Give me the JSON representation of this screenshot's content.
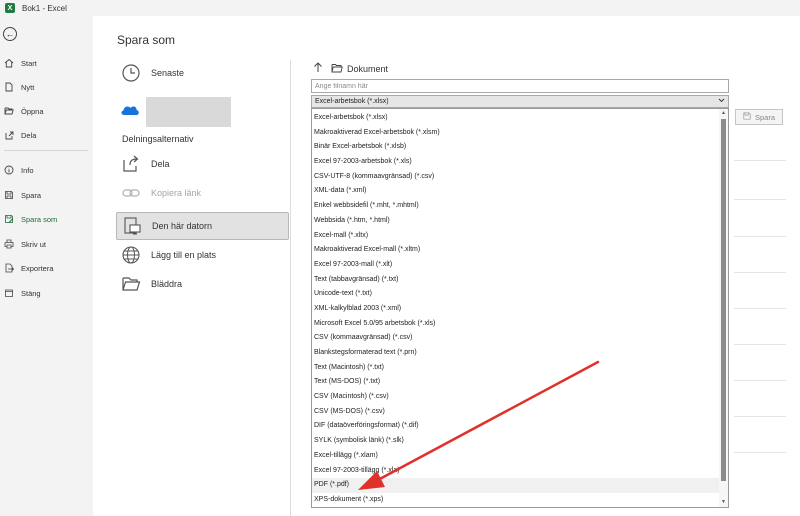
{
  "titlebar": {
    "app_icon": "X",
    "title": "Bok1  -  Excel"
  },
  "nav": {
    "items": [
      {
        "label": "Start",
        "icon": "home-icon"
      },
      {
        "label": "Nytt",
        "icon": "new-document-icon"
      },
      {
        "label": "Öppna",
        "icon": "folder-open-icon"
      },
      {
        "label": "Dela",
        "icon": "share-icon"
      },
      {
        "label": "Info",
        "icon": "info-icon"
      },
      {
        "label": "Spara",
        "icon": "save-icon"
      },
      {
        "label": "Spara som",
        "icon": "save-as-icon",
        "active": true
      },
      {
        "label": "Skriv ut",
        "icon": "print-icon"
      },
      {
        "label": "Exportera",
        "icon": "export-icon"
      },
      {
        "label": "Stäng",
        "icon": "close-document-icon"
      }
    ]
  },
  "page": {
    "heading": "Spara som"
  },
  "locations": {
    "recent": "Senaste",
    "sharing_section": "Delningsalternativ",
    "share": "Dela",
    "copy_link": "Kopiera länk",
    "this_pc": "Den här datorn",
    "add_place": "Lägg till en plats",
    "browse": "Bläddra"
  },
  "path": {
    "folder": "Dokument"
  },
  "filename": {
    "placeholder": "Ange filnamn här"
  },
  "filetype": {
    "selected": "Excel-arbetsbok (*.xlsx)"
  },
  "save_button": "Spara",
  "dropdown_options": [
    "Excel-arbetsbok (*.xlsx)",
    "Makroaktiverad Excel-arbetsbok (*.xlsm)",
    "Binär Excel-arbetsbok (*.xlsb)",
    "Excel 97-2003-arbetsbok (*.xls)",
    "CSV-UTF-8 (kommaavgränsad) (*.csv)",
    "XML-data (*.xml)",
    "Enkel webbsidefil (*.mht, *.mhtml)",
    "Webbsida (*.htm, *.html)",
    "Excel-mall (*.xltx)",
    "Makroaktiverad Excel-mall (*.xltm)",
    "Excel 97-2003-mall (*.xlt)",
    "Text (tabbavgränsad) (*.txt)",
    "Unicode-text (*.txt)",
    "XML-kalkylblad 2003 (*.xml)",
    "Microsoft Excel 5.0/95 arbetsbok (*.xls)",
    "CSV (kommaavgränsad) (*.csv)",
    "Blankstegsformaterad text (*.prn)",
    "Text (Macintosh) (*.txt)",
    "Text (MS-DOS) (*.txt)",
    "CSV (Macintosh) (*.csv)",
    "CSV (MS-DOS) (*.csv)",
    "DIF (dataöverföringsformat) (*.dif)",
    "SYLK (symbolisk länk) (*.slk)",
    "Excel-tillägg (*.xlam)",
    "Excel 97-2003-tillägg (*.xla)",
    "PDF (*.pdf)",
    "XPS-dokument (*.xps)"
  ],
  "highlighted_option": "PDF (*.pdf)",
  "colors": {
    "accent_green": "#1e6b3a",
    "annotation_arrow": "#e0302a"
  }
}
